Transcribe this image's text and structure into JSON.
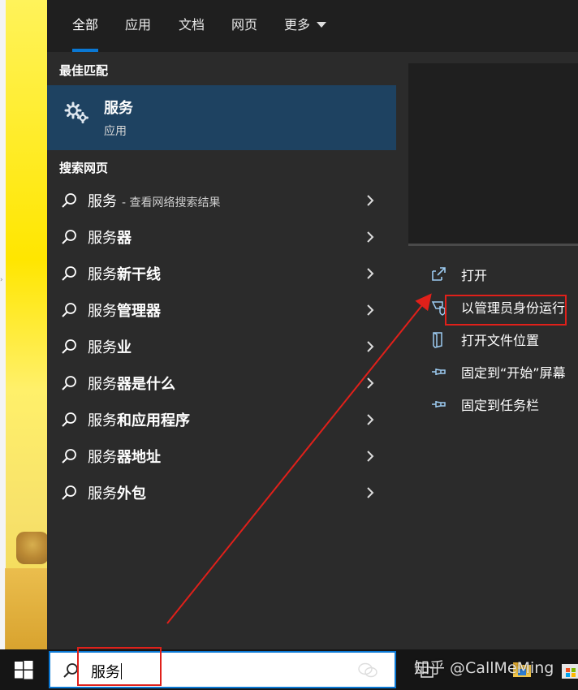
{
  "tabs": [
    {
      "label": "全部",
      "active": true
    },
    {
      "label": "应用",
      "active": false
    },
    {
      "label": "文档",
      "active": false
    },
    {
      "label": "网页",
      "active": false
    },
    {
      "label": "更多",
      "active": false
    }
  ],
  "best_match": {
    "section_title": "最佳匹配",
    "name": "服务",
    "type": "应用",
    "icon": "gear-icon"
  },
  "web_search": {
    "section_title": "搜索网页",
    "items": [
      {
        "query": "服务",
        "suffix": "",
        "sub": "- 查看网络搜索结果"
      },
      {
        "query": "服务",
        "suffix": "器",
        "sub": ""
      },
      {
        "query": "服务",
        "suffix": "新干线",
        "sub": ""
      },
      {
        "query": "服务",
        "suffix": "管理器",
        "sub": ""
      },
      {
        "query": "服务",
        "suffix": "业",
        "sub": ""
      },
      {
        "query": "服务",
        "suffix": "器是什么",
        "sub": ""
      },
      {
        "query": "服务",
        "suffix": "和应用程序",
        "sub": ""
      },
      {
        "query": "服务",
        "suffix": "器地址",
        "sub": ""
      },
      {
        "query": "服务",
        "suffix": "外包",
        "sub": ""
      }
    ]
  },
  "actions": [
    {
      "label": "打开",
      "icon": "open-icon"
    },
    {
      "label": "以管理员身份运行",
      "icon": "shield-icon"
    },
    {
      "label": "打开文件位置",
      "icon": "file-location-icon"
    },
    {
      "label": "固定到“开始”屏幕",
      "icon": "pin-icon"
    },
    {
      "label": "固定到任务栏",
      "icon": "pin-icon"
    }
  ],
  "taskbar": {
    "search_value": "服务",
    "watermark": "知乎 @CallMeMing"
  },
  "colors": {
    "accent": "#0a78d4",
    "highlight": "#1e4261",
    "annotation": "#e0201a"
  }
}
